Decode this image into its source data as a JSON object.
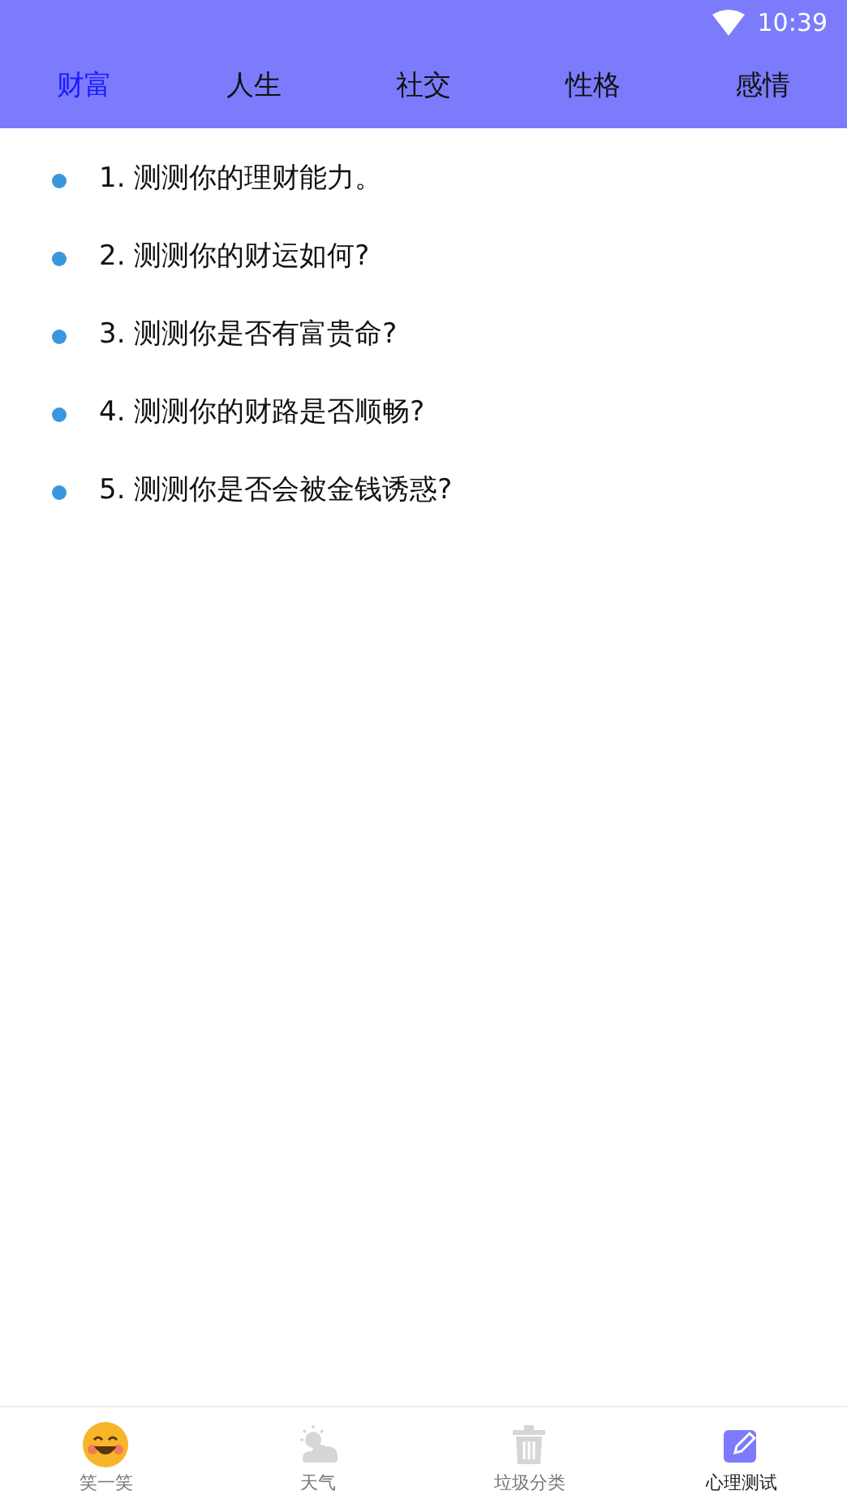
{
  "status_bar": {
    "time": "10:39"
  },
  "tabs": [
    {
      "label": "财富",
      "selected": true
    },
    {
      "label": "人生",
      "selected": false
    },
    {
      "label": "社交",
      "selected": false
    },
    {
      "label": "性格",
      "selected": false
    },
    {
      "label": "感情",
      "selected": false
    }
  ],
  "items": [
    "1. 测测你的理财能力。",
    "2. 测测你的财运如何?",
    "3. 测测你是否有富贵命?",
    "4. 测测你的财路是否顺畅?",
    "5. 测测你是否会被金钱诱惑?"
  ],
  "bottom_nav": [
    {
      "kind": "smile",
      "label": "笑一笑",
      "selected": false
    },
    {
      "kind": "weather",
      "label": "天气",
      "selected": false
    },
    {
      "kind": "trash",
      "label": "垃圾分类",
      "selected": false
    },
    {
      "kind": "edit",
      "label": "心理测试",
      "selected": true
    }
  ]
}
